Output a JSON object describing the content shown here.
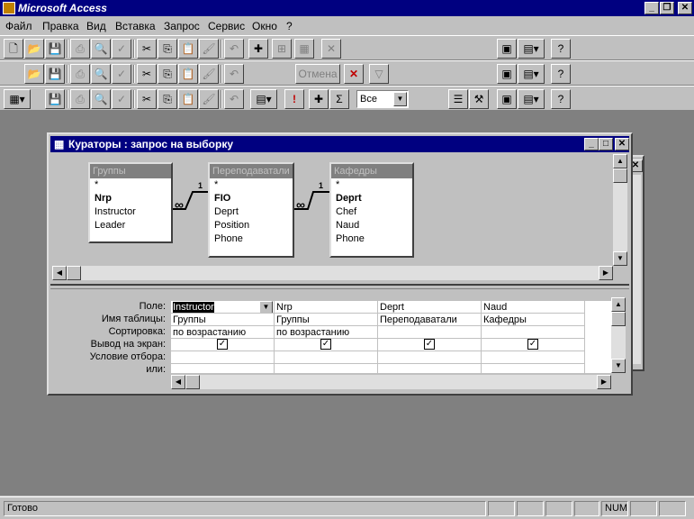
{
  "app": {
    "title": "Microsoft Access"
  },
  "menu": [
    "Файл",
    "Правка",
    "Вид",
    "Вставка",
    "Запрос",
    "Сервис",
    "Окно",
    "?"
  ],
  "toolbar2": {
    "cancel_label": "Отмена"
  },
  "toolbar3": {
    "combo_value": "Все"
  },
  "query_window": {
    "title": "Кураторы : запрос на выборку",
    "tables": [
      {
        "name": "Группы",
        "fields": [
          "*",
          "Nrp",
          "Instructor",
          "Leader"
        ],
        "key": "Nrp"
      },
      {
        "name": "Переподаватали",
        "fields": [
          "*",
          "FIO",
          "Deprt",
          "Position",
          "Phone"
        ],
        "key": "FIO"
      },
      {
        "name": "Кафедры",
        "fields": [
          "*",
          "Deprt",
          "Chef",
          "Naud",
          "Phone"
        ],
        "key": "Deprt"
      }
    ],
    "relations": [
      {
        "one": "1",
        "many": "∞"
      },
      {
        "one": "1",
        "many": "∞"
      }
    ],
    "grid": {
      "row_labels": [
        "Поле:",
        "Имя таблицы:",
        "Сортировка:",
        "Вывод на экран:",
        "Условие отбора:",
        "или:"
      ],
      "columns": [
        {
          "field": "Instructor",
          "table": "Группы",
          "sort": "по возрастанию",
          "show": true
        },
        {
          "field": "Nrp",
          "table": "Группы",
          "sort": "по возрастанию",
          "show": true
        },
        {
          "field": "Deprt",
          "table": "Переподаватали",
          "sort": "",
          "show": true
        },
        {
          "field": "Naud",
          "table": "Кафедры",
          "sort": "",
          "show": true
        }
      ]
    }
  },
  "status": {
    "text": "Готово",
    "num": "NUM"
  }
}
